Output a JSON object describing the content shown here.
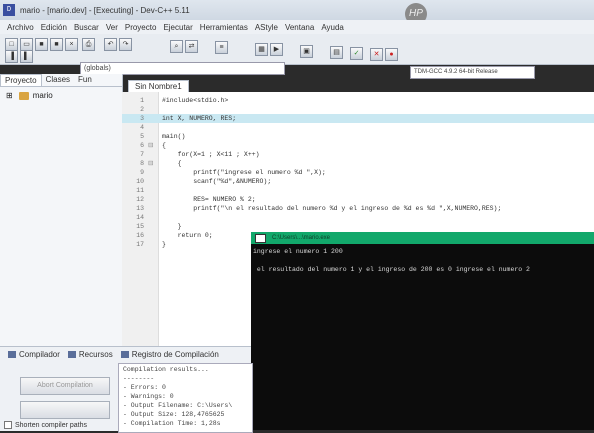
{
  "window": {
    "title": "mario - [mario.dev] - [Executing] - Dev-C++ 5.11",
    "icon": "devcpp-icon",
    "logo": "HP"
  },
  "menu": [
    "Archivo",
    "Edición",
    "Buscar",
    "Ver",
    "Proyecto",
    "Ejecutar",
    "Herramientas",
    "AStyle",
    "Ventana",
    "Ayuda"
  ],
  "toolbar": {
    "scope": "(globals)",
    "compiler": "TDM-GCC 4.9.2 64-bit Release"
  },
  "left_panel": {
    "tabs": [
      "Proyecto",
      "Clases",
      "Fun"
    ],
    "project_name": "mario"
  },
  "editor": {
    "file_tab": "Sin Nombre1",
    "lines": [
      {
        "n": "1",
        "fold": "",
        "code": "#include<stdio.h>"
      },
      {
        "n": "2",
        "fold": "",
        "code": ""
      },
      {
        "n": "3",
        "fold": "",
        "code": "int X, NUMERO, RES;"
      },
      {
        "n": "4",
        "fold": "",
        "code": ""
      },
      {
        "n": "5",
        "fold": "",
        "code": "main()"
      },
      {
        "n": "6",
        "fold": "⊟",
        "code": "{"
      },
      {
        "n": "7",
        "fold": "",
        "code": "    for(X=1 ; X<11 ; X++)"
      },
      {
        "n": "8",
        "fold": "⊟",
        "code": "    {"
      },
      {
        "n": "9",
        "fold": "",
        "code": "        printf(\"ingrese el numero %d \",X);"
      },
      {
        "n": "10",
        "fold": "",
        "code": "        scanf(\"%d\",&NUMERO);"
      },
      {
        "n": "11",
        "fold": "",
        "code": ""
      },
      {
        "n": "12",
        "fold": "",
        "code": "        RES= NUMERO % 2;"
      },
      {
        "n": "13",
        "fold": "",
        "code": "        printf(\"\\n el resultado del numero %d y el ingreso de %d es %d \",X,NUMERO,RES);"
      },
      {
        "n": "14",
        "fold": "",
        "code": ""
      },
      {
        "n": "15",
        "fold": "",
        "code": "    }"
      },
      {
        "n": "16",
        "fold": "",
        "code": "    return 0;"
      },
      {
        "n": "17",
        "fold": "",
        "code": "}"
      }
    ],
    "highlight_line": "3"
  },
  "console": {
    "title": "C:\\Users\\...\\mario.exe",
    "lines": [
      "ingrese el numero 1 200",
      "",
      " el resultado del numero 1 y el ingreso de 200 es 0 ingrese el numero 2"
    ]
  },
  "bottom": {
    "tabs": [
      "Compilador",
      "Recursos",
      "Registro de Compilación"
    ],
    "abort_button": "Abort Compilation",
    "shorten_label": "Shorten compiler paths",
    "output": [
      "Compilation results...",
      "--------",
      "- Errors: 0",
      "- Warnings: 0",
      "- Output Filename: C:\\Users\\",
      "- Output Size: 128,4765625",
      "- Compilation Time: 1,28s"
    ]
  }
}
